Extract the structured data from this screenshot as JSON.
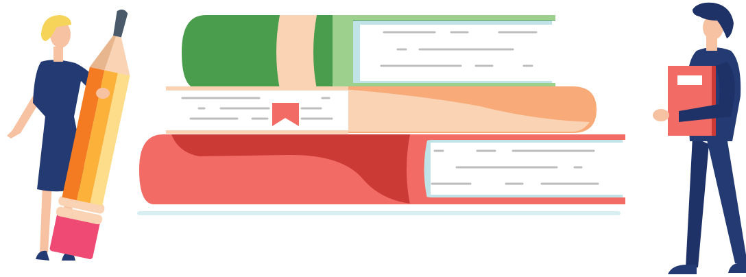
{
  "scene": {
    "title": ""
  },
  "palette": {
    "green_dark": "#4a9d4c",
    "green_light": "#9ed08d",
    "peach": "#f9d3b4",
    "orange": "#f8ab79",
    "red_dark": "#cc3a36",
    "red_light": "#f26b64",
    "page_cyan": "#bfe3e6",
    "navy": "#243a73",
    "skin": "#f7c2a2",
    "hair_blonde": "#f6d45a",
    "pencil_orange": "#f47b22",
    "pencil_yellow": "#fcb13a",
    "eraser_pink": "#ee4a74",
    "text_line_gray": "#bdbdbd"
  },
  "illustration": {
    "books": [
      "green-book",
      "peach-book",
      "red-book"
    ],
    "bookmark": "bookmark-icon",
    "woman": "woman-with-pencil",
    "man": "man-with-book"
  }
}
